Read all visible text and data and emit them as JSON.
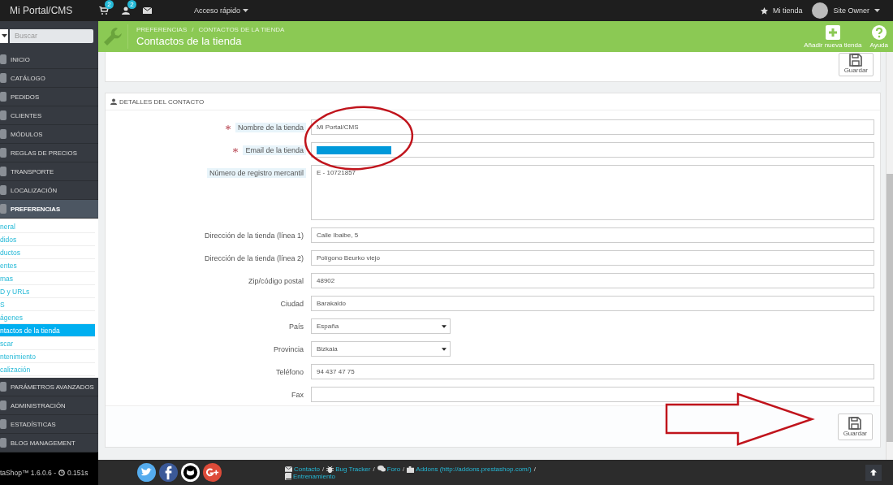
{
  "top_bar": {
    "brand": "Mi Portal/CMS",
    "badges": [
      {
        "kind": "cart",
        "count": "2"
      },
      {
        "kind": "user",
        "count": "2"
      },
      {
        "kind": "mail"
      }
    ],
    "quick_access": "Acceso rápido",
    "shop_link": "Mi tienda",
    "user": "Site Owner"
  },
  "sidebar": {
    "search_placeholder": "Buscar",
    "items": [
      {
        "label": "INICIO",
        "selected": false
      },
      {
        "label": "CATÁLOGO",
        "selected": false
      },
      {
        "label": "PEDIDOS",
        "selected": false
      },
      {
        "label": "CLIENTES",
        "selected": false
      },
      {
        "label": "MÓDULOS",
        "selected": false
      },
      {
        "label": "REGLAS DE PRECIOS",
        "selected": false
      },
      {
        "label": "TRANSPORTE",
        "selected": false
      },
      {
        "label": "LOCALIZACIÓN",
        "selected": false
      },
      {
        "label": "PREFERENCIAS",
        "selected": true,
        "children": [
          {
            "label": "neral",
            "selected": false
          },
          {
            "label": "didos",
            "selected": false
          },
          {
            "label": "ductos",
            "selected": false
          },
          {
            "label": "entes",
            "selected": false
          },
          {
            "label": "mas",
            "selected": false
          },
          {
            "label": "D y URLs",
            "selected": false
          },
          {
            "label": "S",
            "selected": false
          },
          {
            "label": "ágenes",
            "selected": false
          },
          {
            "label": "ntactos de la tienda",
            "selected": true
          },
          {
            "label": "scar",
            "selected": false
          },
          {
            "label": "ntenimiento",
            "selected": false
          },
          {
            "label": "calización",
            "selected": false
          }
        ]
      },
      {
        "label": "PARÁMETROS AVANZADOS",
        "selected": false
      },
      {
        "label": "ADMINISTRACIÓN",
        "selected": false
      },
      {
        "label": "ESTADÍSTICAS",
        "selected": false
      },
      {
        "label": "BLOG MANAGEMENT",
        "selected": false
      }
    ],
    "version": "taShop™ 1.6.0.6 -",
    "timing": "0.151s"
  },
  "header": {
    "breadcrumb": [
      "PREFERENCIAS",
      "CONTACTOS DE LA TIENDA"
    ],
    "breadcrumb_sep": "/",
    "title": "Contactos de la tienda",
    "actions": [
      {
        "kind": "add",
        "label": "Añadir nueva tienda"
      },
      {
        "kind": "help",
        "label": "Ayuda"
      }
    ]
  },
  "top_panel": {
    "save": "Guardar"
  },
  "form": {
    "title": "DETALLES DEL CONTACTO",
    "fields": [
      {
        "label": "Nombre de la tienda",
        "required": true,
        "hint": true,
        "kind": "text",
        "value": "Mi Portal/CMS"
      },
      {
        "label": "Email de la tienda",
        "required": true,
        "hint": true,
        "kind": "text",
        "redacted": true
      },
      {
        "label": "Número de registro mercantil",
        "required": false,
        "hint": true,
        "kind": "textarea",
        "value": "E - 10721857"
      },
      {
        "label": "Dirección de la tienda (línea 1)",
        "required": false,
        "hint": false,
        "kind": "text",
        "value": "Calle Ibaibe, 5"
      },
      {
        "label": "Dirección de la tienda (línea 2)",
        "required": false,
        "hint": false,
        "kind": "text",
        "value": "Polígono Beurko viejo"
      },
      {
        "label": "Zip/código postal",
        "required": false,
        "hint": false,
        "kind": "text",
        "value": "48902"
      },
      {
        "label": "Ciudad",
        "required": false,
        "hint": false,
        "kind": "text",
        "value": "Barakaldo"
      },
      {
        "label": "País",
        "required": false,
        "hint": false,
        "kind": "select",
        "value": "España"
      },
      {
        "label": "Provincia",
        "required": false,
        "hint": false,
        "kind": "select",
        "value": "Bizkaia"
      },
      {
        "label": "Teléfono",
        "required": false,
        "hint": false,
        "kind": "text",
        "value": "94 437 47 75"
      },
      {
        "label": "Fax",
        "required": false,
        "hint": false,
        "kind": "text"
      }
    ],
    "save": "Guardar"
  },
  "footer": {
    "links": [
      {
        "kind": "mail",
        "label": "Contacto",
        "sep": "/"
      },
      {
        "kind": "bug",
        "label": "Bug Tracker",
        "sep": "/"
      },
      {
        "kind": "chat",
        "label": "Foro",
        "sep": "/"
      },
      {
        "kind": "puzzle",
        "label": "Addons (http://addons.prestashop.com/)",
        "sep": "/"
      },
      {
        "kind": "book",
        "label": "Entrenamiento"
      }
    ]
  }
}
